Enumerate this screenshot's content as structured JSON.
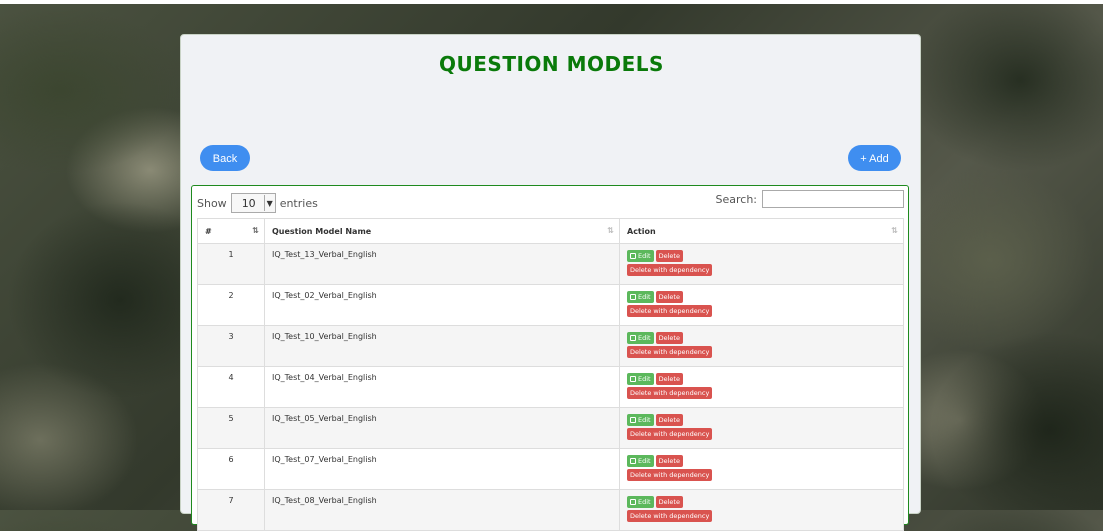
{
  "page": {
    "title": "QUESTION MODELS",
    "back_label": "Back",
    "add_label": "+ Add"
  },
  "table_controls": {
    "show_label": "Show",
    "entries_value": "10",
    "entries_label": "entries",
    "search_label": "Search:",
    "search_value": ""
  },
  "table": {
    "columns": [
      "#",
      "Question Model Name",
      "Action"
    ],
    "action_labels": {
      "edit": "Edit",
      "delete": "Delete",
      "delete_dependency": "Delete with dependency"
    },
    "rows": [
      {
        "num": "1",
        "name": "IQ_Test_13_Verbal_English"
      },
      {
        "num": "2",
        "name": "IQ_Test_02_Verbal_English"
      },
      {
        "num": "3",
        "name": "IQ_Test_10_Verbal_English"
      },
      {
        "num": "4",
        "name": "IQ_Test_04_Verbal_English"
      },
      {
        "num": "5",
        "name": "IQ_Test_05_Verbal_English"
      },
      {
        "num": "6",
        "name": "IQ_Test_07_Verbal_English"
      },
      {
        "num": "7",
        "name": "IQ_Test_08_Verbal_English"
      }
    ]
  },
  "colors": {
    "title": "#0a7a0a",
    "primary_button": "#3f8ef0",
    "edit_button": "#5cb85c",
    "delete_button": "#d9534f",
    "table_border": "#1e8a1e"
  },
  "icons": [
    "edit-icon",
    "sort-icon",
    "chevron-down-icon"
  ]
}
